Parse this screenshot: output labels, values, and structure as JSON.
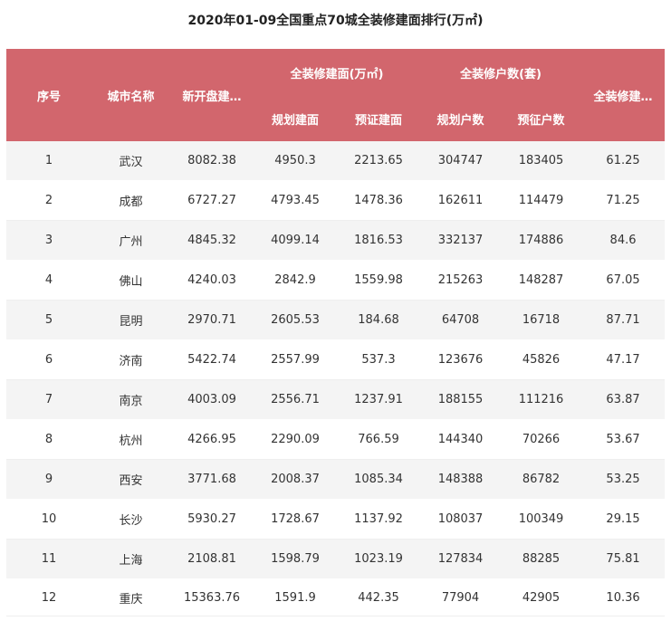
{
  "title": "2020年01-09全国重点70城全装修建面排行(万㎡)",
  "headers": {
    "rank": "序号",
    "city": "城市名称",
    "new_open": "新开盘建…",
    "area_group": "全装修建面(万㎡)",
    "planned_area": "规划建面",
    "presale_area": "预证建面",
    "units_group": "全装修户数(套)",
    "planned_units": "规划户数",
    "presale_units": "预征户数",
    "ratio": "全装修建…"
  },
  "rows": [
    {
      "rank": "1",
      "city": "武汉",
      "new_open": "8082.38",
      "planned_area": "4950.3",
      "presale_area": "2213.65",
      "planned_units": "304747",
      "presale_units": "183405",
      "ratio": "61.25"
    },
    {
      "rank": "2",
      "city": "成都",
      "new_open": "6727.27",
      "planned_area": "4793.45",
      "presale_area": "1478.36",
      "planned_units": "162611",
      "presale_units": "114479",
      "ratio": "71.25"
    },
    {
      "rank": "3",
      "city": "广州",
      "new_open": "4845.32",
      "planned_area": "4099.14",
      "presale_area": "1816.53",
      "planned_units": "332137",
      "presale_units": "174886",
      "ratio": "84.6"
    },
    {
      "rank": "4",
      "city": "佛山",
      "new_open": "4240.03",
      "planned_area": "2842.9",
      "presale_area": "1559.98",
      "planned_units": "215263",
      "presale_units": "148287",
      "ratio": "67.05"
    },
    {
      "rank": "5",
      "city": "昆明",
      "new_open": "2970.71",
      "planned_area": "2605.53",
      "presale_area": "184.68",
      "planned_units": "64708",
      "presale_units": "16718",
      "ratio": "87.71"
    },
    {
      "rank": "6",
      "city": "济南",
      "new_open": "5422.74",
      "planned_area": "2557.99",
      "presale_area": "537.3",
      "planned_units": "123676",
      "presale_units": "45826",
      "ratio": "47.17"
    },
    {
      "rank": "7",
      "city": "南京",
      "new_open": "4003.09",
      "planned_area": "2556.71",
      "presale_area": "1237.91",
      "planned_units": "188155",
      "presale_units": "111216",
      "ratio": "63.87"
    },
    {
      "rank": "8",
      "city": "杭州",
      "new_open": "4266.95",
      "planned_area": "2290.09",
      "presale_area": "766.59",
      "planned_units": "144340",
      "presale_units": "70266",
      "ratio": "53.67"
    },
    {
      "rank": "9",
      "city": "西安",
      "new_open": "3771.68",
      "planned_area": "2008.37",
      "presale_area": "1085.34",
      "planned_units": "148388",
      "presale_units": "86782",
      "ratio": "53.25"
    },
    {
      "rank": "10",
      "city": "长沙",
      "new_open": "5930.27",
      "planned_area": "1728.67",
      "presale_area": "1137.92",
      "planned_units": "108037",
      "presale_units": "100349",
      "ratio": "29.15"
    },
    {
      "rank": "11",
      "city": "上海",
      "new_open": "2108.81",
      "planned_area": "1598.79",
      "presale_area": "1023.19",
      "planned_units": "127834",
      "presale_units": "88285",
      "ratio": "75.81"
    },
    {
      "rank": "12",
      "city": "重庆",
      "new_open": "15363.76",
      "planned_area": "1591.9",
      "presale_area": "442.35",
      "planned_units": "77904",
      "presale_units": "42905",
      "ratio": "10.36"
    }
  ]
}
